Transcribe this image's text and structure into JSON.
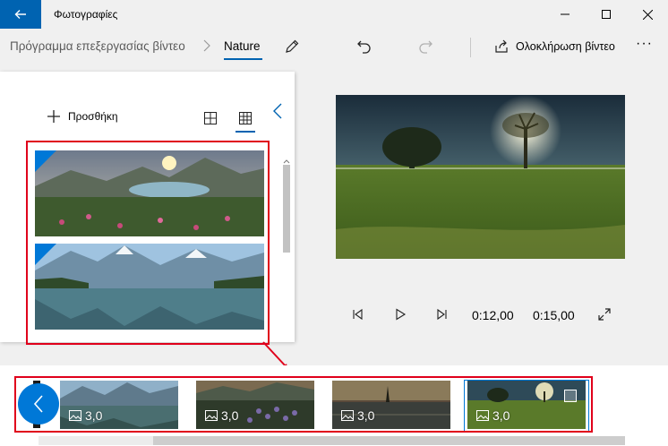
{
  "window": {
    "title": "Φωτογραφίες"
  },
  "toolbar": {
    "breadcrumb_root": "Πρόγραμμα επεξεργασίας βίντεο",
    "breadcrumb_current": "Nature",
    "finish_label": "Ολοκλήρωση βίντεο",
    "more_label": "···"
  },
  "library": {
    "add_label": "Προσθήκη",
    "items": [
      {
        "icon": "landscape-lake-flowers"
      },
      {
        "icon": "landscape-mountain-lake"
      },
      {
        "icon": "landscape-partial"
      }
    ]
  },
  "player": {
    "current_time": "0:12,00",
    "total_time": "0:15,00"
  },
  "storyboard": {
    "cards": [
      {
        "duration": "3,0"
      },
      {
        "duration": "3,0"
      },
      {
        "duration": "3,0"
      },
      {
        "duration": "3,0"
      }
    ]
  },
  "colors": {
    "accent": "#0063b1",
    "highlight": "#e0001b",
    "storyboard_button": "#0078d7"
  }
}
